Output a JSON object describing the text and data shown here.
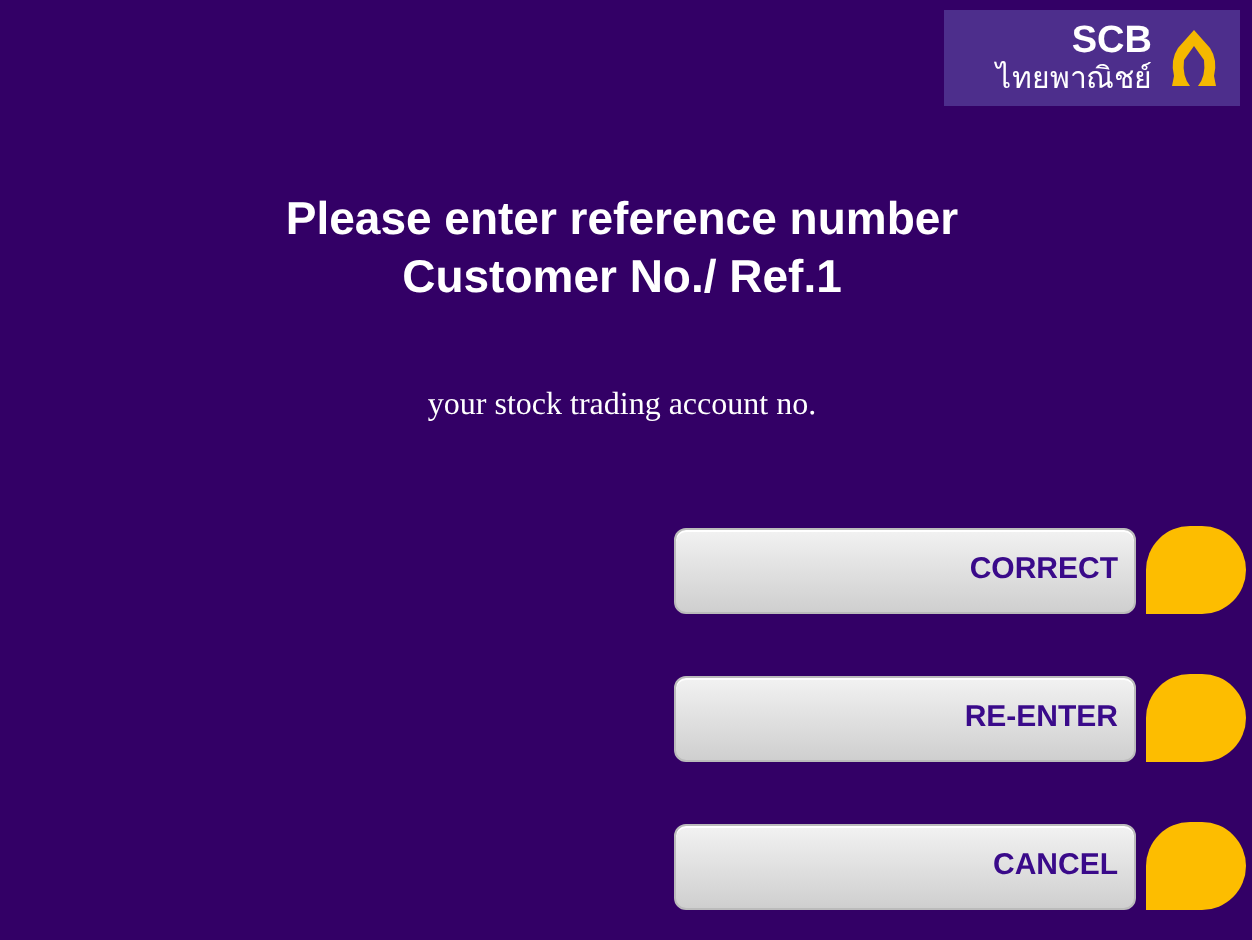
{
  "logo": {
    "brand": "SCB",
    "thai_name": "ไทยพาณิชย์"
  },
  "prompt": {
    "title_lines": [
      "Please enter reference number",
      "Customer No./ Ref.1"
    ],
    "hint": "your stock trading account no."
  },
  "buttons": [
    {
      "label": "CORRECT"
    },
    {
      "label": "RE-ENTER"
    },
    {
      "label": "CANCEL"
    }
  ]
}
